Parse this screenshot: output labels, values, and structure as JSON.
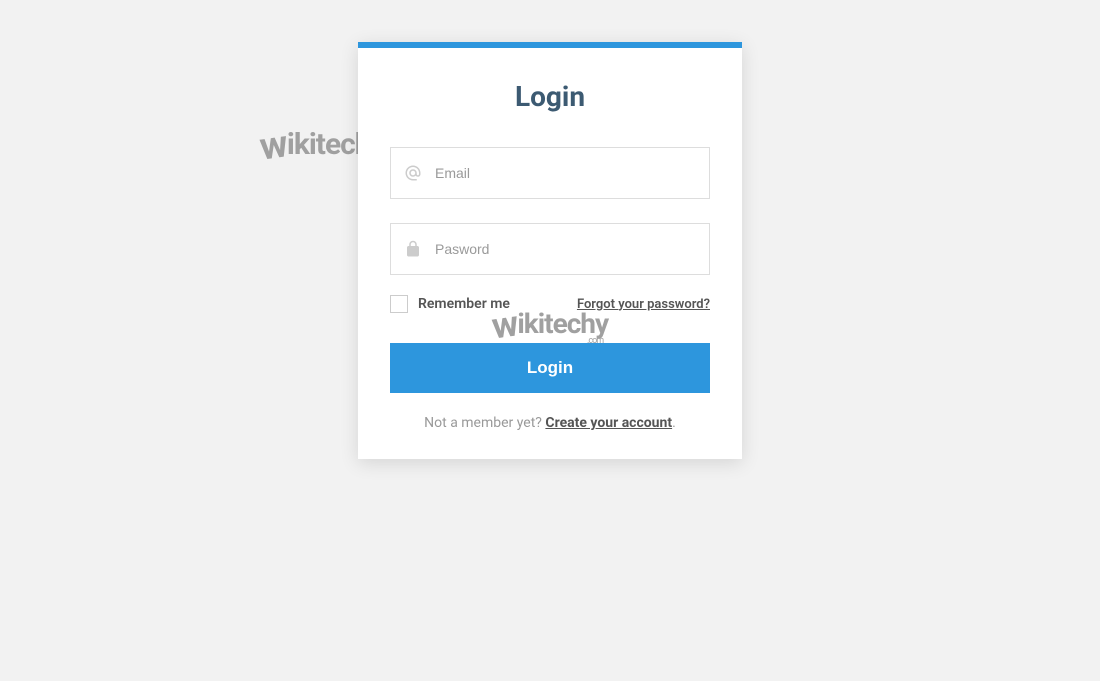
{
  "watermark": {
    "brand_first_letter": "w",
    "brand_rest": "ikitechy",
    "brand_tld": ".com"
  },
  "login": {
    "title": "Login",
    "email_placeholder": "Email",
    "password_placeholder": "Pasword",
    "remember_label": "Remember me",
    "forgot_label": "Forgot your password?",
    "submit_label": "Login",
    "signup_prompt": "Not a member yet? ",
    "signup_link": "Create your account",
    "signup_suffix": "."
  },
  "colors": {
    "accent": "#2d96dd",
    "bg": "#f2f2f2",
    "title": "#3c5a72"
  }
}
